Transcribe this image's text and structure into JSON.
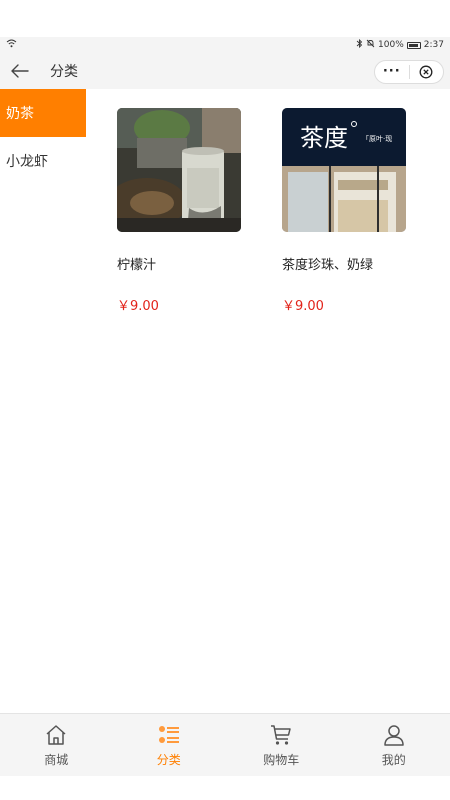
{
  "status_bar": {
    "battery": "100%",
    "time": "2:37"
  },
  "nav": {
    "title": "分类",
    "more": "···"
  },
  "sidebar": {
    "items": [
      {
        "label": "奶茶",
        "active": true
      },
      {
        "label": "小龙虾",
        "active": false
      }
    ]
  },
  "products": [
    {
      "name": "柠檬汁",
      "price": "￥9.00"
    },
    {
      "name": "茶度珍珠、奶绿",
      "price": "￥9.00",
      "sign_text": "茶度",
      "sign_small": "「原叶·现"
    }
  ],
  "tabbar": {
    "items": [
      {
        "label": "商城",
        "icon": "home-icon"
      },
      {
        "label": "分类",
        "icon": "category-icon",
        "active": true
      },
      {
        "label": "购物车",
        "icon": "cart-icon"
      },
      {
        "label": "我的",
        "icon": "user-icon"
      }
    ]
  },
  "colors": {
    "accent": "#ff7f00",
    "price": "#e2231a"
  }
}
